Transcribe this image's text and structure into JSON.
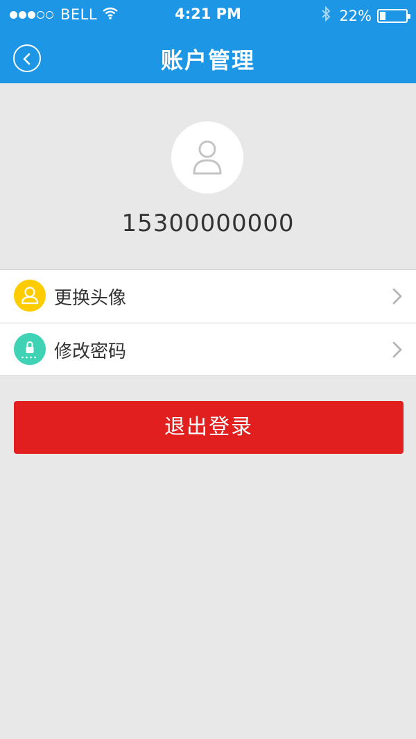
{
  "status_bar": {
    "carrier": "BELL",
    "time": "4:21 PM",
    "battery": "22%",
    "battery_level": 0.22,
    "signal_bars_filled": 3
  },
  "nav": {
    "title": "账户管理",
    "back_icon": "back-arrow-icon"
  },
  "profile": {
    "avatar_icon": "user-icon",
    "phone": "15300000000"
  },
  "menu": {
    "items": [
      {
        "label": "更换头像",
        "icon": "user-icon",
        "color": "#ffcc00"
      },
      {
        "label": "修改密码",
        "icon": "lock-icon",
        "color": "#3fd2b4"
      }
    ]
  },
  "logout": {
    "label": "退出登录"
  },
  "colors": {
    "header": "#1e96e6",
    "background": "#e8e8e8",
    "logout": "#e21f1f"
  }
}
